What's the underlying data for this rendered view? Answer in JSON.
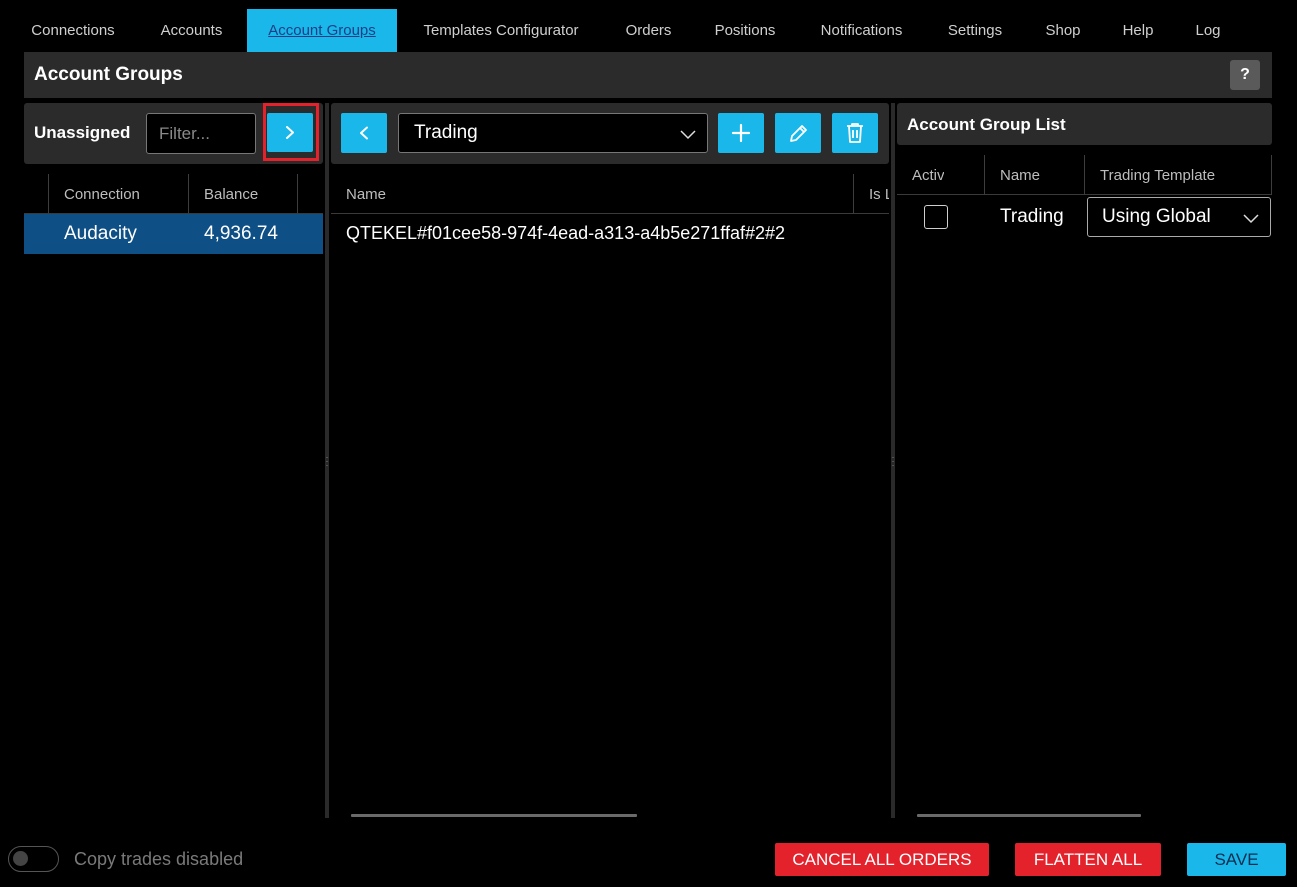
{
  "nav": {
    "tabs": [
      {
        "label": "Connections"
      },
      {
        "label": "Accounts"
      },
      {
        "label": "Account Groups",
        "active": true
      },
      {
        "label": "Templates Configurator"
      },
      {
        "label": "Orders"
      },
      {
        "label": "Positions"
      },
      {
        "label": "Notifications"
      },
      {
        "label": "Settings"
      },
      {
        "label": "Shop"
      },
      {
        "label": "Help"
      },
      {
        "label": "Log"
      }
    ]
  },
  "page": {
    "title": "Account Groups",
    "help_label": "?"
  },
  "unassigned": {
    "label": "Unassigned",
    "filter_placeholder": "Filter...",
    "columns": [
      "Connection",
      "Balance"
    ],
    "rows": [
      {
        "connection": "Audacity",
        "balance": "4,936.74",
        "selected": true
      }
    ]
  },
  "group_editor": {
    "selected_group": "Trading",
    "columns": [
      "Name",
      "Is L"
    ],
    "rows": [
      {
        "name": "QTEKEL#f01cee58-974f-4ead-a313-a4b5e271ffaf#2#2"
      }
    ]
  },
  "group_list": {
    "title": "Account Group List",
    "columns": [
      "Activ",
      "Name",
      "Trading Template"
    ],
    "rows": [
      {
        "active": false,
        "name": "Trading",
        "template": "Using Global"
      }
    ]
  },
  "footer": {
    "copy_status": "Copy trades disabled",
    "cancel_all_label": "CANCEL ALL ORDERS",
    "flatten_all_label": "FLATTEN ALL",
    "save_label": "SAVE"
  },
  "colors": {
    "accent": "#1ab8ea",
    "danger": "#e3222c",
    "selected_row": "#0e4f85",
    "panel": "#2b2b2b"
  }
}
